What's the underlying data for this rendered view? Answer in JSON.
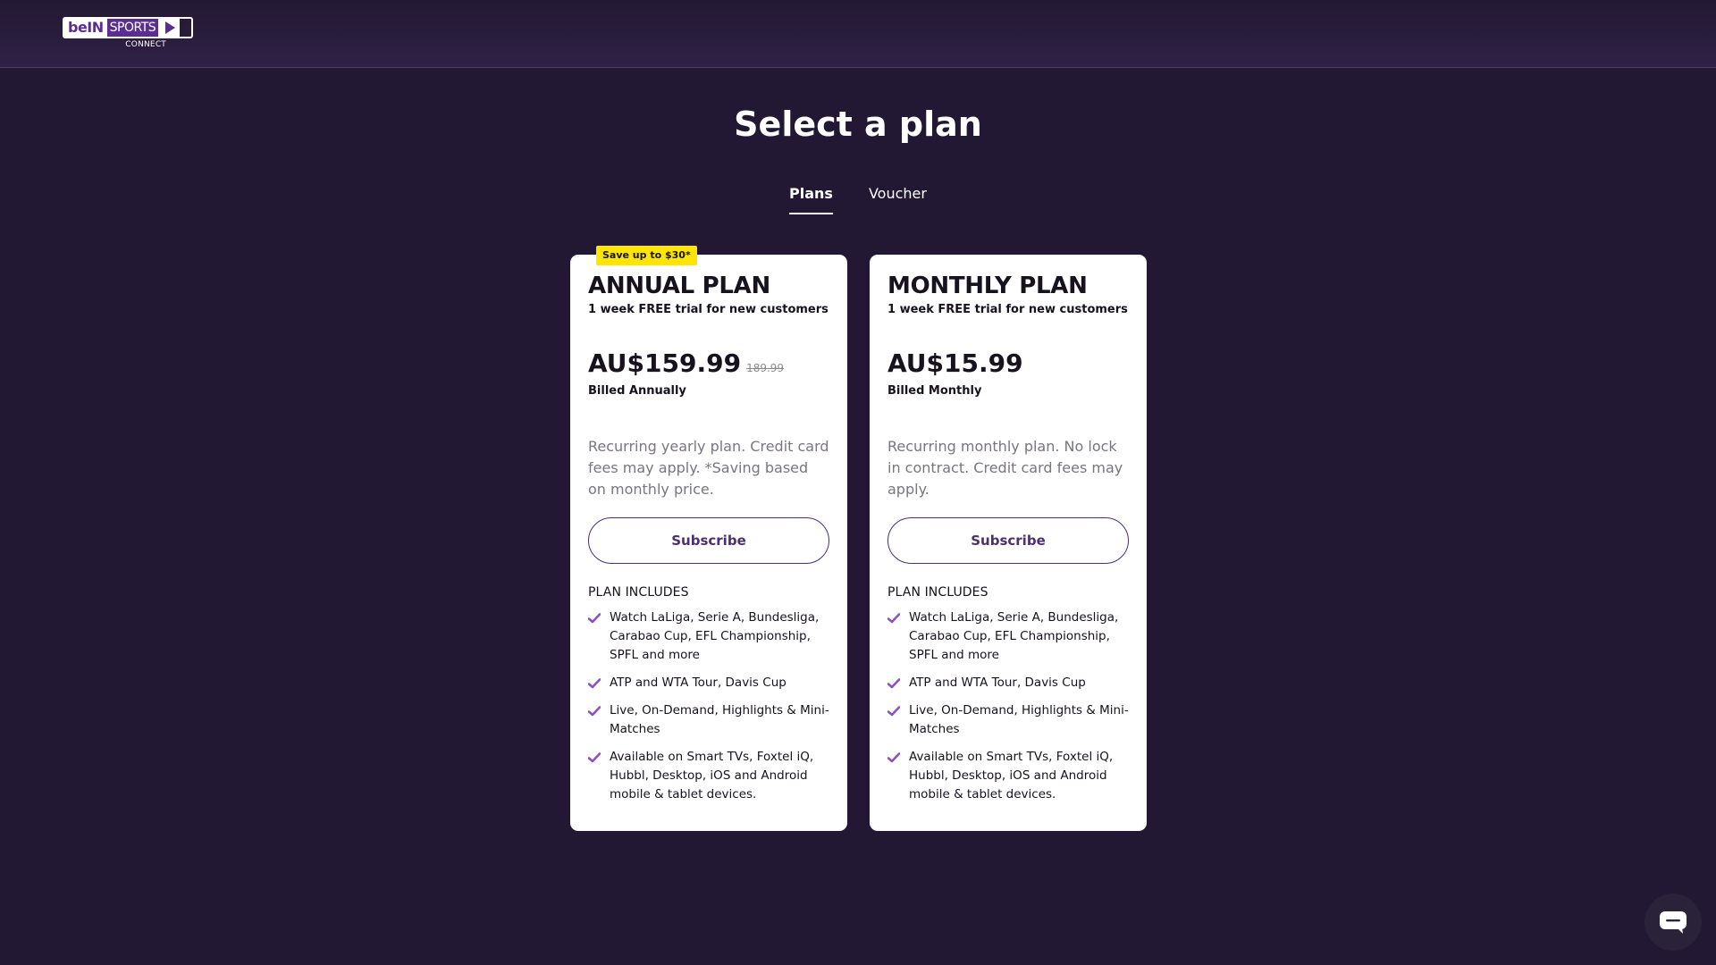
{
  "header": {
    "logo": {
      "brand_a": "beIN",
      "brand_b": "SPORTS",
      "sub": "CONNECT"
    }
  },
  "page": {
    "title": "Select a plan"
  },
  "tabs": [
    {
      "label": "Plans",
      "active": true
    },
    {
      "label": "Voucher",
      "active": false
    }
  ],
  "plans": [
    {
      "badge": "Save up to $30*",
      "name": "ANNUAL PLAN",
      "trial": "1 week FREE trial for new customers",
      "price": "AU$159.99",
      "old_price": "189.99",
      "billed": "Billed Annually",
      "description": "Recurring yearly plan. Credit card fees may apply. *Saving based on monthly price.",
      "button_label": "Subscribe",
      "includes_title": "PLAN INCLUDES",
      "features": [
        "Watch LaLiga, Serie A, Bundesliga, Carabao Cup, EFL Championship, SPFL and more",
        "ATP and WTA Tour, Davis Cup",
        "Live, On-Demand, Highlights & Mini-Matches",
        "Available on Smart TVs, Foxtel iQ, Hubbl, Desktop, iOS and Android mobile & tablet devices."
      ]
    },
    {
      "badge": "",
      "name": "MONTHLY PLAN",
      "trial": "1 week FREE trial for new customers",
      "price": "AU$15.99",
      "old_price": "",
      "billed": "Billed Monthly",
      "description": "Recurring monthly plan. No lock in contract. Credit card fees may apply.",
      "button_label": "Subscribe",
      "includes_title": "PLAN INCLUDES",
      "features": [
        "Watch LaLiga, Serie A, Bundesliga, Carabao Cup, EFL Championship, SPFL and more",
        "ATP and WTA Tour, Davis Cup",
        "Live, On-Demand, Highlights & Mini-Matches",
        "Available on Smart TVs, Foxtel iQ, Hubbl, Desktop, iOS and Android mobile & tablet devices."
      ]
    }
  ],
  "icons": {
    "check": "check-icon",
    "chat": "chat-bubble-icon"
  },
  "colors": {
    "background": "#231833",
    "accent": "#5a2d91",
    "check": "#8a52c4",
    "badge": "#ffe600",
    "button_text": "#4b2f6e"
  }
}
